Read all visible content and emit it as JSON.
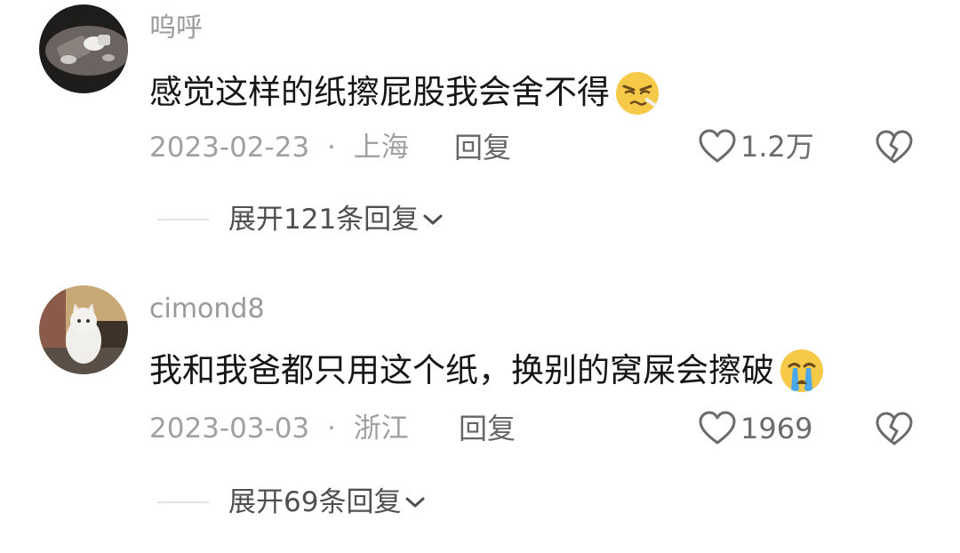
{
  "comments": [
    {
      "username": "呜呼",
      "text": "感觉这样的纸擦屁股我会舍不得",
      "emoji_icon": "smirk-emoji-icon",
      "date": "2023-02-23",
      "separator": "·",
      "location": "上海",
      "reply_label": "回复",
      "like_count": "1.2万",
      "expand_label": "展开121条回复"
    },
    {
      "username": "cimond8",
      "text": "我和我爸都只用这个纸，换别的窝屎会擦破",
      "emoji_icon": "crying-emoji-icon",
      "date": "2023-03-03",
      "separator": "·",
      "location": "浙江",
      "reply_label": "回复",
      "like_count": "1969",
      "expand_label": "展开69条回复"
    }
  ],
  "colors": {
    "text": "#161616",
    "muted": "#a0a0a0",
    "emoji_yellow": "#f7c948",
    "tear_blue": "#4aa8e8"
  }
}
